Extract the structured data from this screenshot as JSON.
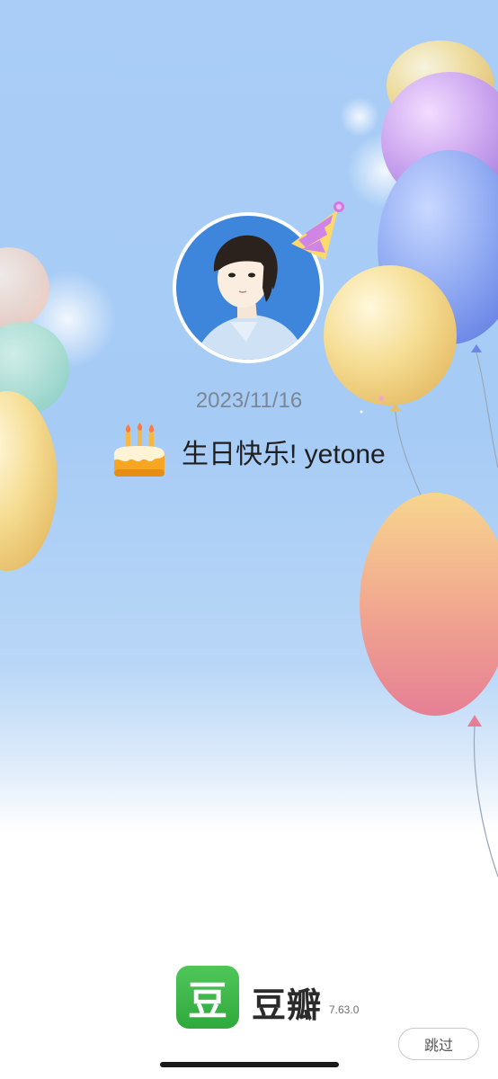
{
  "splash": {
    "date": "2023/11/16",
    "greeting": "生日快乐! yetone",
    "cake_icon": "birthday-cake-icon",
    "hat_icon": "party-hat-icon"
  },
  "brand": {
    "logo_char": "豆",
    "name": "豆瓣",
    "version": "7.63.0",
    "accent": "#3cb54a"
  },
  "actions": {
    "skip_label": "跳过"
  },
  "colors": {
    "sky": "#a9cdf6",
    "balloon_yellow": "#f3dc8e",
    "balloon_purple": "#c9a2ee",
    "balloon_blue": "#7f9ff0",
    "balloon_pink": "#ec8da0"
  }
}
